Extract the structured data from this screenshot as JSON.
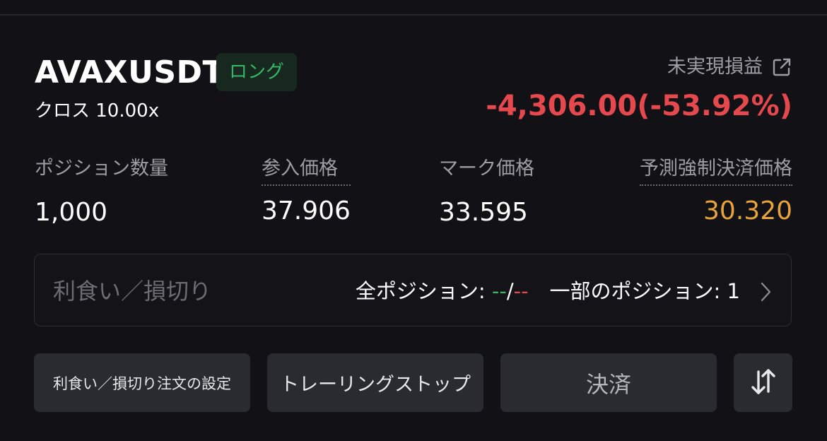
{
  "position": {
    "symbol": "AVAXUSDT",
    "side": "ロング",
    "margin_mode": "クロス 10.00x",
    "pnl_label": "未実現損益",
    "pnl_value": "-4,306.00(-53.92%)"
  },
  "stats": {
    "size_label": "ポジション数量",
    "size_value": "1,000",
    "entry_label": "参入価格",
    "entry_value": "37.906",
    "mark_label": "マーク価格",
    "mark_value": "33.595",
    "liq_label": "予測強制決済価格",
    "liq_value": "30.320"
  },
  "tpsl": {
    "title": "利食い／損切り",
    "all_label": "全ポジション: ",
    "all_tp": "--",
    "separator": "/",
    "all_sl": "--",
    "partial_label": "一部のポジション: 1"
  },
  "buttons": {
    "tpsl_settings": "利食い／損切り注文の設定",
    "trailing_stop": "トレーリングストップ",
    "close": "決済"
  },
  "icons": {
    "share": "external-link-icon",
    "chevron": "chevron-right-icon",
    "swap": "swap-arrows-icon"
  },
  "colors": {
    "profit": "#36b667",
    "loss": "#e5484d",
    "liquidation": "#e8a33d"
  }
}
